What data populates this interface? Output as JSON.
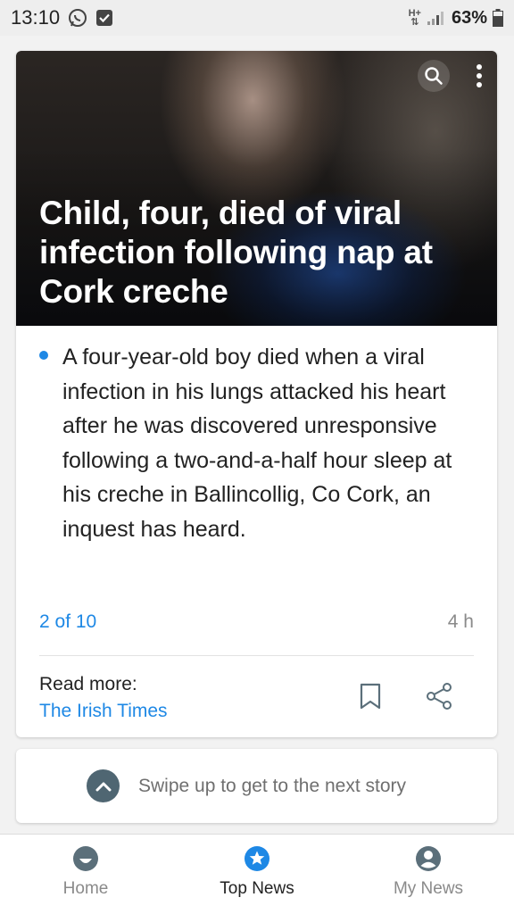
{
  "status_bar": {
    "time": "13:10",
    "battery": "63%",
    "network": "H+"
  },
  "article": {
    "title": "Child, four, died of viral infection following nap at Cork creche",
    "summary": "A four-year-old boy died when a viral infection in his lungs attacked his heart after he was discovered unresponsive following a two-and-a-half hour sleep at his creche in Ballincollig, Co Cork, an inquest has heard.",
    "counter": "2 of 10",
    "age": "4 h",
    "read_more_label": "Read more:",
    "source": "The Irish Times"
  },
  "swipe": {
    "text": "Swipe up to get to the next story"
  },
  "nav": {
    "items": [
      {
        "label": "Home",
        "icon": "smile-icon",
        "active": false
      },
      {
        "label": "Top News",
        "icon": "star-icon",
        "active": true
      },
      {
        "label": "My News",
        "icon": "person-icon",
        "active": false
      }
    ]
  },
  "colors": {
    "accent": "#1e88e5",
    "nav_icon": "#5b6f7a",
    "swipe_icon": "#4f6672"
  }
}
